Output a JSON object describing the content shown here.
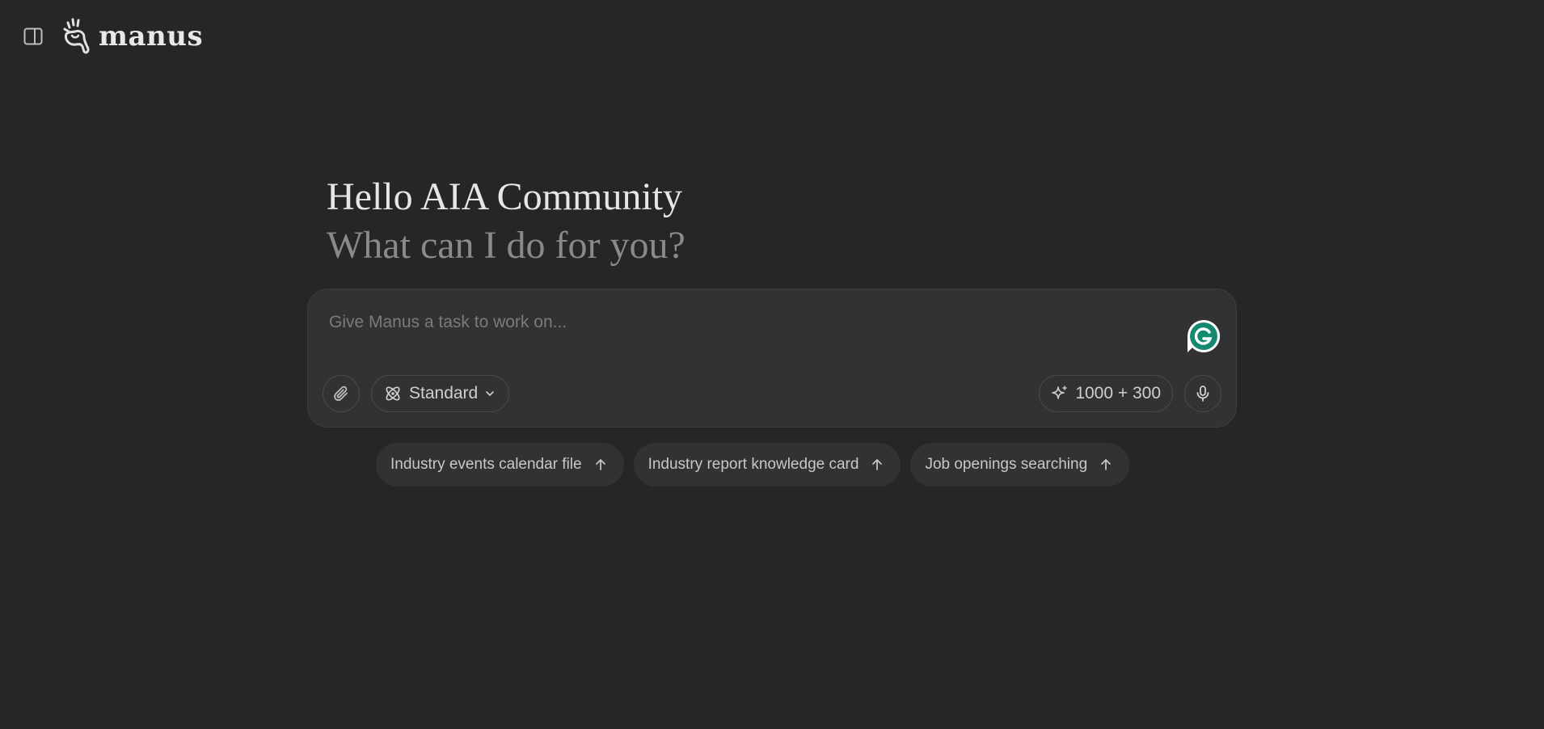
{
  "header": {
    "logo_text": "manus"
  },
  "greeting": {
    "title": "Hello AIA Community",
    "subtitle": "What can I do for you?"
  },
  "composer": {
    "placeholder": "Give Manus a task to work on...",
    "mode_label": "Standard",
    "credits_label": "1000 + 300"
  },
  "suggestions": [
    {
      "label": "Industry events calendar file"
    },
    {
      "label": "Industry report knowledge card"
    },
    {
      "label": "Job openings searching"
    }
  ],
  "colors": {
    "background": "#262626",
    "composer_bg": "#323234",
    "grammarly_green": "#15896f"
  },
  "icons": {
    "sidebar_toggle": "sidebar-icon",
    "logo": "manus-hand-logo",
    "attach": "paperclip-icon",
    "mode": "atom-icon",
    "credits": "sparkle-icon",
    "mic": "microphone-icon",
    "suggestion_arrow": "arrow-up-icon"
  }
}
